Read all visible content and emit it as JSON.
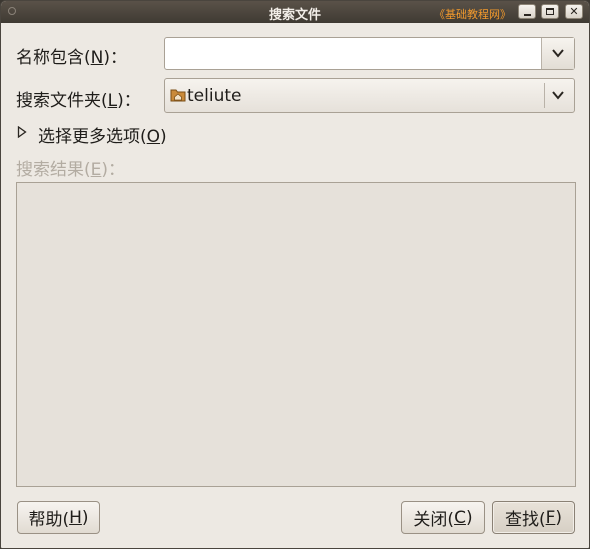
{
  "window": {
    "title": "搜索文件",
    "watermark": "《基础教程网》"
  },
  "form": {
    "name_label_prefix": "名称包含(",
    "name_label_key": "N",
    "name_label_suffix": ")：",
    "name_value": "",
    "folder_label_prefix": "搜索文件夹(",
    "folder_label_key": "L",
    "folder_label_suffix": ")：",
    "folder_value": "teliute",
    "more_options_prefix": "选择更多选项(",
    "more_options_key": "O",
    "more_options_suffix": ")",
    "results_label_prefix": "搜索结果(",
    "results_label_key": "E",
    "results_label_suffix": ")："
  },
  "buttons": {
    "help_prefix": "帮助(",
    "help_key": "H",
    "help_suffix": ")",
    "close_prefix": "关闭(",
    "close_key": "C",
    "close_suffix": ")",
    "find_prefix": "查找(",
    "find_key": "F",
    "find_suffix": ")"
  },
  "icons": {
    "folder": "home-folder-icon",
    "dropdown": "chevron-down-icon",
    "expander": "triangle-right-icon"
  },
  "colors": {
    "window_bg": "#ede9e3",
    "titlebar": "#4a443c",
    "watermark": "#f39a2c",
    "disabled_text": "#b3aca2"
  }
}
